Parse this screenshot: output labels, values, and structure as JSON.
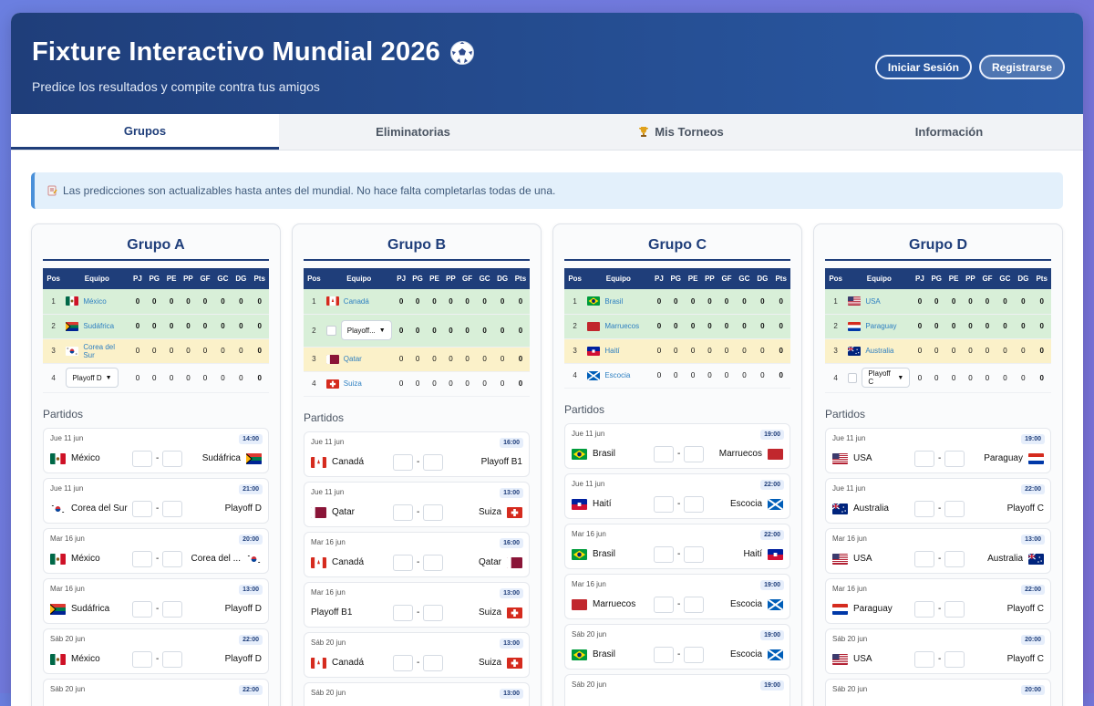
{
  "header": {
    "title": "Fixture Interactivo Mundial 2026",
    "subtitle": "Predice los resultados y compite contra tus amigos",
    "login_label": "Iniciar Sesión",
    "register_label": "Registrarse"
  },
  "tabs": [
    {
      "label": "Grupos",
      "active": true
    },
    {
      "label": "Eliminatorias",
      "active": false
    },
    {
      "label": "Mis Torneos",
      "icon": "trophy-icon",
      "active": false
    },
    {
      "label": "Información",
      "active": false
    }
  ],
  "alert": {
    "icon": "memo-icon",
    "text": "Las predicciones son actualizables hasta antes del mundial. No hace falta completarlas todas de una."
  },
  "table_headers": {
    "pos": "Pos",
    "team": "Equipo",
    "pj": "PJ",
    "pg": "PG",
    "pe": "PE",
    "pp": "PP",
    "gf": "GF",
    "gc": "GC",
    "dg": "DG",
    "pts": "Pts"
  },
  "partidos_label": "Partidos",
  "score_separator": "-",
  "groups": [
    {
      "title": "Grupo A",
      "standings": [
        {
          "pos": "1",
          "team": "México",
          "flag": "mx",
          "status": "q",
          "stats": [
            "0",
            "0",
            "0",
            "0",
            "0",
            "0",
            "0",
            "0"
          ]
        },
        {
          "pos": "2",
          "team": "Sudáfrica",
          "flag": "za",
          "status": "q",
          "stats": [
            "0",
            "0",
            "0",
            "0",
            "0",
            "0",
            "0",
            "0"
          ]
        },
        {
          "pos": "3",
          "team": "Corea del Sur",
          "flag": "kr",
          "status": "y",
          "stats": [
            "0",
            "0",
            "0",
            "0",
            "0",
            "0",
            "0",
            "0"
          ]
        },
        {
          "pos": "4",
          "team": "Playoff D",
          "dropdown": true,
          "status": "n",
          "stats": [
            "0",
            "0",
            "0",
            "0",
            "0",
            "0",
            "0",
            "0"
          ]
        }
      ],
      "matches": [
        {
          "date": "Jue 11 jun",
          "time": "14:00",
          "home": "México",
          "home_flag": "mx",
          "away": "Sudáfrica",
          "away_flag": "za",
          "home_score": "",
          "away_score": ""
        },
        {
          "date": "Jue 11 jun",
          "time": "21:00",
          "home": "Corea del Sur",
          "home_flag": "kr",
          "away": "Playoff D",
          "away_flag": "",
          "home_score": "",
          "away_score": ""
        },
        {
          "date": "Mar 16 jun",
          "time": "20:00",
          "home": "México",
          "home_flag": "mx",
          "away": "Corea del ...",
          "away_flag": "kr",
          "home_score": "",
          "away_score": ""
        },
        {
          "date": "Mar 16 jun",
          "time": "13:00",
          "home": "Sudáfrica",
          "home_flag": "za",
          "away": "Playoff D",
          "away_flag": "",
          "home_score": "",
          "away_score": ""
        },
        {
          "date": "Sáb 20 jun",
          "time": "22:00",
          "home": "México",
          "home_flag": "mx",
          "away": "Playoff D",
          "away_flag": "",
          "home_score": "",
          "away_score": ""
        },
        {
          "date": "Sáb 20 jun",
          "time": "22:00",
          "home": "",
          "home_flag": "",
          "away": "",
          "away_flag": "",
          "home_score": "",
          "away_score": ""
        }
      ]
    },
    {
      "title": "Grupo B",
      "standings": [
        {
          "pos": "1",
          "team": "Canadá",
          "flag": "ca",
          "status": "q",
          "stats": [
            "0",
            "0",
            "0",
            "0",
            "0",
            "0",
            "0",
            "0"
          ]
        },
        {
          "pos": "2",
          "team": "Playoff...",
          "dropdown": true,
          "checkbox": true,
          "status": "q",
          "stats": [
            "0",
            "0",
            "0",
            "0",
            "0",
            "0",
            "0",
            "0"
          ]
        },
        {
          "pos": "3",
          "team": "Qatar",
          "flag": "qa",
          "status": "y",
          "stats": [
            "0",
            "0",
            "0",
            "0",
            "0",
            "0",
            "0",
            "0"
          ]
        },
        {
          "pos": "4",
          "team": "Suiza",
          "flag": "ch",
          "status": "n",
          "stats": [
            "0",
            "0",
            "0",
            "0",
            "0",
            "0",
            "0",
            "0"
          ]
        }
      ],
      "matches": [
        {
          "date": "Jue 11 jun",
          "time": "16:00",
          "home": "Canadá",
          "home_flag": "ca",
          "away": "Playoff B1",
          "away_flag": "",
          "home_score": "",
          "away_score": ""
        },
        {
          "date": "Jue 11 jun",
          "time": "13:00",
          "home": "Qatar",
          "home_flag": "qa",
          "away": "Suiza",
          "away_flag": "ch",
          "home_score": "",
          "away_score": ""
        },
        {
          "date": "Mar 16 jun",
          "time": "16:00",
          "home": "Canadá",
          "home_flag": "ca",
          "away": "Qatar",
          "away_flag": "qa",
          "home_score": "",
          "away_score": ""
        },
        {
          "date": "Mar 16 jun",
          "time": "13:00",
          "home": "Playoff B1",
          "home_flag": "",
          "away": "Suiza",
          "away_flag": "ch",
          "home_score": "",
          "away_score": ""
        },
        {
          "date": "Sáb 20 jun",
          "time": "13:00",
          "home": "Canadá",
          "home_flag": "ca",
          "away": "Suiza",
          "away_flag": "ch",
          "home_score": "",
          "away_score": ""
        },
        {
          "date": "Sáb 20 jun",
          "time": "13:00",
          "home": "",
          "home_flag": "",
          "away": "",
          "away_flag": "",
          "home_score": "",
          "away_score": ""
        }
      ]
    },
    {
      "title": "Grupo C",
      "standings": [
        {
          "pos": "1",
          "team": "Brasil",
          "flag": "br",
          "status": "q",
          "stats": [
            "0",
            "0",
            "0",
            "0",
            "0",
            "0",
            "0",
            "0"
          ]
        },
        {
          "pos": "2",
          "team": "Marruecos",
          "flag": "ma",
          "status": "q",
          "stats": [
            "0",
            "0",
            "0",
            "0",
            "0",
            "0",
            "0",
            "0"
          ]
        },
        {
          "pos": "3",
          "team": "Haití",
          "flag": "ht",
          "status": "y",
          "stats": [
            "0",
            "0",
            "0",
            "0",
            "0",
            "0",
            "0",
            "0"
          ]
        },
        {
          "pos": "4",
          "team": "Escocia",
          "flag": "sco",
          "status": "n",
          "stats": [
            "0",
            "0",
            "0",
            "0",
            "0",
            "0",
            "0",
            "0"
          ]
        }
      ],
      "matches": [
        {
          "date": "Jue 11 jun",
          "time": "19:00",
          "home": "Brasil",
          "home_flag": "br",
          "away": "Marruecos",
          "away_flag": "ma",
          "home_score": "",
          "away_score": ""
        },
        {
          "date": "Jue 11 jun",
          "time": "22:00",
          "home": "Haití",
          "home_flag": "ht",
          "away": "Escocia",
          "away_flag": "sco",
          "home_score": "",
          "away_score": ""
        },
        {
          "date": "Mar 16 jun",
          "time": "22:00",
          "home": "Brasil",
          "home_flag": "br",
          "away": "Haití",
          "away_flag": "ht",
          "home_score": "",
          "away_score": ""
        },
        {
          "date": "Mar 16 jun",
          "time": "19:00",
          "home": "Marruecos",
          "home_flag": "ma",
          "away": "Escocia",
          "away_flag": "sco",
          "home_score": "",
          "away_score": ""
        },
        {
          "date": "Sáb 20 jun",
          "time": "19:00",
          "home": "Brasil",
          "home_flag": "br",
          "away": "Escocia",
          "away_flag": "sco",
          "home_score": "",
          "away_score": ""
        },
        {
          "date": "Sáb 20 jun",
          "time": "19:00",
          "home": "",
          "home_flag": "",
          "away": "",
          "away_flag": "",
          "home_score": "",
          "away_score": ""
        }
      ]
    },
    {
      "title": "Grupo D",
      "standings": [
        {
          "pos": "1",
          "team": "USA",
          "flag": "us",
          "status": "q",
          "stats": [
            "0",
            "0",
            "0",
            "0",
            "0",
            "0",
            "0",
            "0"
          ]
        },
        {
          "pos": "2",
          "team": "Paraguay",
          "flag": "py",
          "status": "q",
          "stats": [
            "0",
            "0",
            "0",
            "0",
            "0",
            "0",
            "0",
            "0"
          ]
        },
        {
          "pos": "3",
          "team": "Australia",
          "flag": "au",
          "status": "y",
          "stats": [
            "0",
            "0",
            "0",
            "0",
            "0",
            "0",
            "0",
            "0"
          ]
        },
        {
          "pos": "4",
          "team": "Playoff C",
          "dropdown": true,
          "checkbox": true,
          "status": "n",
          "stats": [
            "0",
            "0",
            "0",
            "0",
            "0",
            "0",
            "0",
            "0"
          ]
        }
      ],
      "matches": [
        {
          "date": "Jue 11 jun",
          "time": "19:00",
          "home": "USA",
          "home_flag": "us",
          "away": "Paraguay",
          "away_flag": "py",
          "home_score": "",
          "away_score": ""
        },
        {
          "date": "Jue 11 jun",
          "time": "22:00",
          "home": "Australia",
          "home_flag": "au",
          "away": "Playoff C",
          "away_flag": "",
          "home_score": "",
          "away_score": ""
        },
        {
          "date": "Mar 16 jun",
          "time": "13:00",
          "home": "USA",
          "home_flag": "us",
          "away": "Australia",
          "away_flag": "au",
          "home_score": "",
          "away_score": ""
        },
        {
          "date": "Mar 16 jun",
          "time": "22:00",
          "home": "Paraguay",
          "home_flag": "py",
          "away": "Playoff C",
          "away_flag": "",
          "home_score": "",
          "away_score": ""
        },
        {
          "date": "Sáb 20 jun",
          "time": "20:00",
          "home": "USA",
          "home_flag": "us",
          "away": "Playoff C",
          "away_flag": "",
          "home_score": "",
          "away_score": ""
        },
        {
          "date": "Sáb 20 jun",
          "time": "20:00",
          "home": "",
          "home_flag": "",
          "away": "",
          "away_flag": "",
          "home_score": "",
          "away_score": ""
        }
      ]
    }
  ],
  "colors": {
    "primary": "#1f3e7a",
    "qualified_row": "#d8efd8",
    "third_row": "#fbf1c9",
    "team_link": "#2d7fc1"
  }
}
